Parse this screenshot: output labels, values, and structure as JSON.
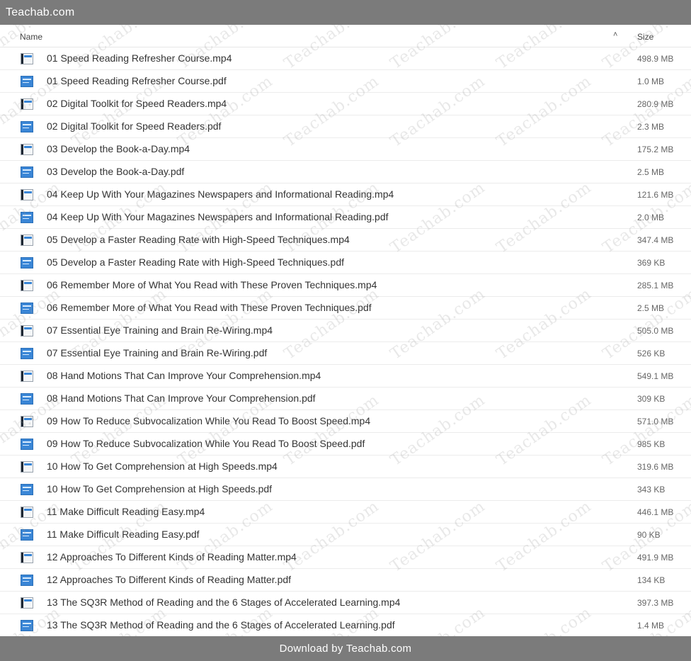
{
  "topbar": {
    "title": "Teachab.com"
  },
  "header": {
    "name_label": "Name",
    "size_label": "Size",
    "sort_glyph": "˄"
  },
  "files": [
    {
      "name": "01 Speed Reading Refresher Course.mp4",
      "size": "498.9 MB",
      "type": "mp4"
    },
    {
      "name": "01 Speed Reading Refresher Course.pdf",
      "size": "1.0 MB",
      "type": "pdf"
    },
    {
      "name": "02 Digital Toolkit for Speed Readers.mp4",
      "size": "280.9 MB",
      "type": "mp4"
    },
    {
      "name": "02 Digital Toolkit for Speed Readers.pdf",
      "size": "2.3 MB",
      "type": "pdf"
    },
    {
      "name": "03 Develop the Book-a-Day.mp4",
      "size": "175.2 MB",
      "type": "mp4"
    },
    {
      "name": "03 Develop the Book-a-Day.pdf",
      "size": "2.5 MB",
      "type": "pdf"
    },
    {
      "name": "04 Keep Up With Your Magazines Newspapers and Informational Reading.mp4",
      "size": "121.6 MB",
      "type": "mp4"
    },
    {
      "name": "04 Keep Up With Your Magazines Newspapers and Informational Reading.pdf",
      "size": "2.0 MB",
      "type": "pdf"
    },
    {
      "name": "05 Develop a Faster Reading Rate with High-Speed Techniques.mp4",
      "size": "347.4 MB",
      "type": "mp4"
    },
    {
      "name": "05 Develop a Faster Reading Rate with High-Speed Techniques.pdf",
      "size": "369 KB",
      "type": "pdf"
    },
    {
      "name": "06 Remember More of What You Read with These Proven Techniques.mp4",
      "size": "285.1 MB",
      "type": "mp4"
    },
    {
      "name": "06 Remember More of What You Read with These Proven Techniques.pdf",
      "size": "2.5 MB",
      "type": "pdf"
    },
    {
      "name": "07 Essential Eye Training and Brain Re-Wiring.mp4",
      "size": "505.0 MB",
      "type": "mp4"
    },
    {
      "name": "07 Essential Eye Training and Brain Re-Wiring.pdf",
      "size": "526 KB",
      "type": "pdf"
    },
    {
      "name": "08 Hand Motions That Can Improve Your Comprehension.mp4",
      "size": "549.1 MB",
      "type": "mp4"
    },
    {
      "name": "08 Hand Motions That Can Improve Your Comprehension.pdf",
      "size": "309 KB",
      "type": "pdf"
    },
    {
      "name": "09 How To Reduce Subvocalization While You Read To Boost Speed.mp4",
      "size": "571.0 MB",
      "type": "mp4"
    },
    {
      "name": "09 How To Reduce Subvocalization While You Read To Boost Speed.pdf",
      "size": "985 KB",
      "type": "pdf"
    },
    {
      "name": "10 How To Get Comprehension at High Speeds.mp4",
      "size": "319.6 MB",
      "type": "mp4"
    },
    {
      "name": "10 How To Get Comprehension at High Speeds.pdf",
      "size": "343 KB",
      "type": "pdf"
    },
    {
      "name": "11 Make Difficult Reading Easy.mp4",
      "size": "446.1 MB",
      "type": "mp4"
    },
    {
      "name": "11 Make Difficult Reading Easy.pdf",
      "size": "90 KB",
      "type": "pdf"
    },
    {
      "name": "12 Approaches To Different Kinds of Reading Matter.mp4",
      "size": "491.9 MB",
      "type": "mp4"
    },
    {
      "name": "12 Approaches To Different Kinds of Reading Matter.pdf",
      "size": "134 KB",
      "type": "pdf"
    },
    {
      "name": "13 The SQ3R Method of Reading and the 6 Stages of Accelerated Learning.mp4",
      "size": "397.3 MB",
      "type": "mp4"
    },
    {
      "name": "13 The SQ3R Method of Reading and the 6 Stages of Accelerated Learning.pdf",
      "size": "1.4 MB",
      "type": "pdf"
    }
  ],
  "watermark": {
    "text": "Teachab.com"
  },
  "bottombar": {
    "text": "Download by Teachab.com"
  }
}
